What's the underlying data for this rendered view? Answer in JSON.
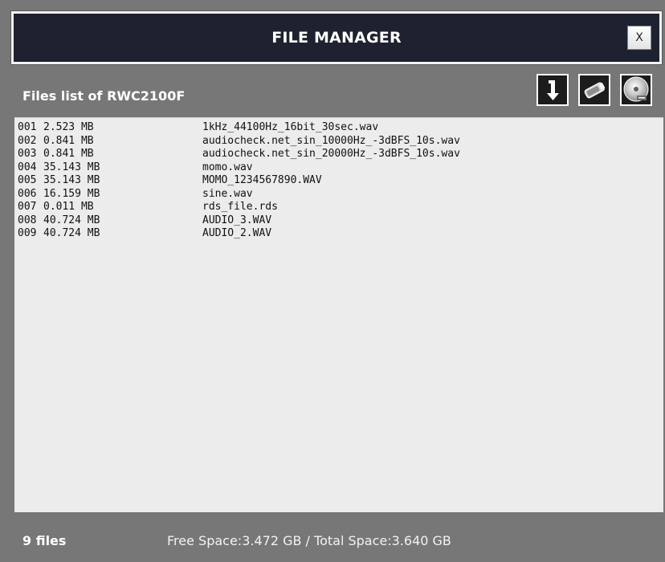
{
  "window": {
    "title": "FILE MANAGER",
    "close_label": "X"
  },
  "toolbar": {
    "list_title": "Files list of RWC2100F",
    "icons": [
      "download-icon",
      "usb-drive-icon",
      "disk-icon"
    ]
  },
  "files": [
    {
      "idx": "001",
      "size": "2.523 MB",
      "name": "1kHz_44100Hz_16bit_30sec.wav"
    },
    {
      "idx": "002",
      "size": "0.841 MB",
      "name": "audiocheck.net_sin_10000Hz_-3dBFS_10s.wav"
    },
    {
      "idx": "003",
      "size": "0.841 MB",
      "name": "audiocheck.net_sin_20000Hz_-3dBFS_10s.wav"
    },
    {
      "idx": "004",
      "size": "35.143 MB",
      "name": "momo.wav"
    },
    {
      "idx": "005",
      "size": "35.143 MB",
      "name": "MOMO_1234567890.WAV"
    },
    {
      "idx": "006",
      "size": "16.159 MB",
      "name": "sine.wav"
    },
    {
      "idx": "007",
      "size": "0.011 MB",
      "name": "rds_file.rds"
    },
    {
      "idx": "008",
      "size": "40.724 MB",
      "name": "AUDIO_3.WAV"
    },
    {
      "idx": "009",
      "size": "40.724 MB",
      "name": "AUDIO_2.WAV"
    }
  ],
  "status": {
    "count": "9 files",
    "space": "Free Space:3.472 GB / Total Space:3.640 GB"
  },
  "colors": {
    "window_bg": "#777777",
    "titlebar_bg": "#1e2230",
    "list_bg": "#ececec",
    "text_light": "#ffffff"
  }
}
